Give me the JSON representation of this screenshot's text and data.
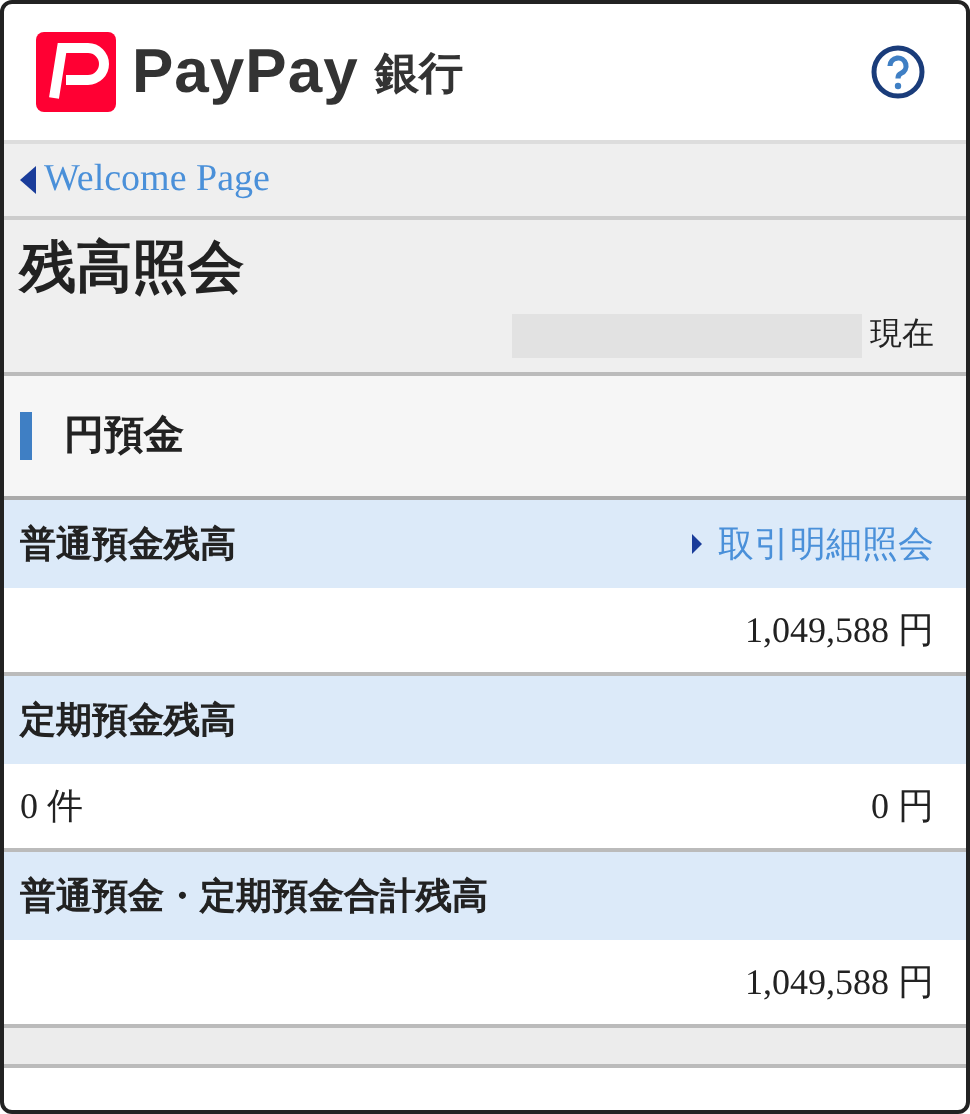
{
  "header": {
    "brand": "PayPay",
    "brand_suffix": "銀行"
  },
  "breadcrumb": {
    "label": "Welcome Page"
  },
  "page_title": "残高照会",
  "as_of_suffix": "現在",
  "section_title": "円預金",
  "balances": [
    {
      "label": "普通預金残高",
      "link": "取引明細照会",
      "value_right": "1,049,588 円"
    },
    {
      "label": "定期預金残高",
      "value_left": "0 件",
      "value_right": "0 円"
    },
    {
      "label": "普通預金・定期預金合計残高",
      "value_right": "1,049,588 円"
    }
  ]
}
